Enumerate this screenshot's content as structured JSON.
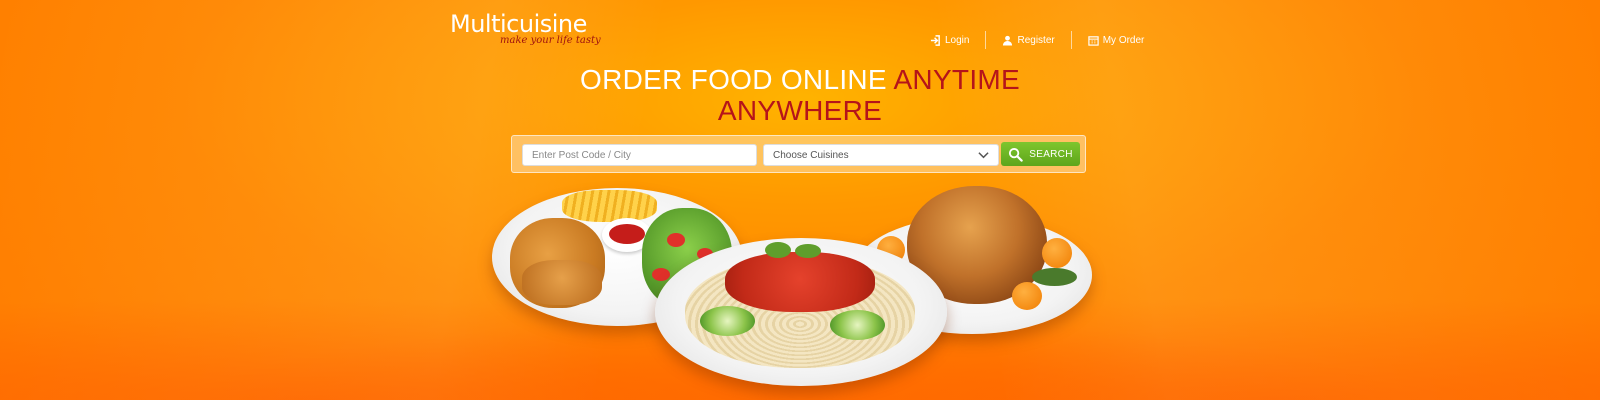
{
  "brand": {
    "name": "Multicuisine",
    "tagline": "make your life tasty"
  },
  "nav": {
    "login": "Login",
    "register": "Register",
    "my_order": "My Order"
  },
  "headline": {
    "white": "ORDER FOOD ONLINE",
    "accent_1": "ANYTIME",
    "accent_2": "ANYWHERE"
  },
  "search": {
    "postcode_placeholder": "Enter Post Code / City",
    "postcode_value": "",
    "cuisine_selected": "Choose Cuisines",
    "button_label": "SEARCH"
  },
  "colors": {
    "background": "#ff8c00",
    "accent": "#b5141a",
    "search_button": "#6cb524",
    "tagline": "#a0140f"
  },
  "icons": {
    "login": "login-icon",
    "register": "user-icon",
    "my_order": "calendar-icon",
    "search": "search-icon",
    "dropdown": "chevron-down-icon"
  }
}
